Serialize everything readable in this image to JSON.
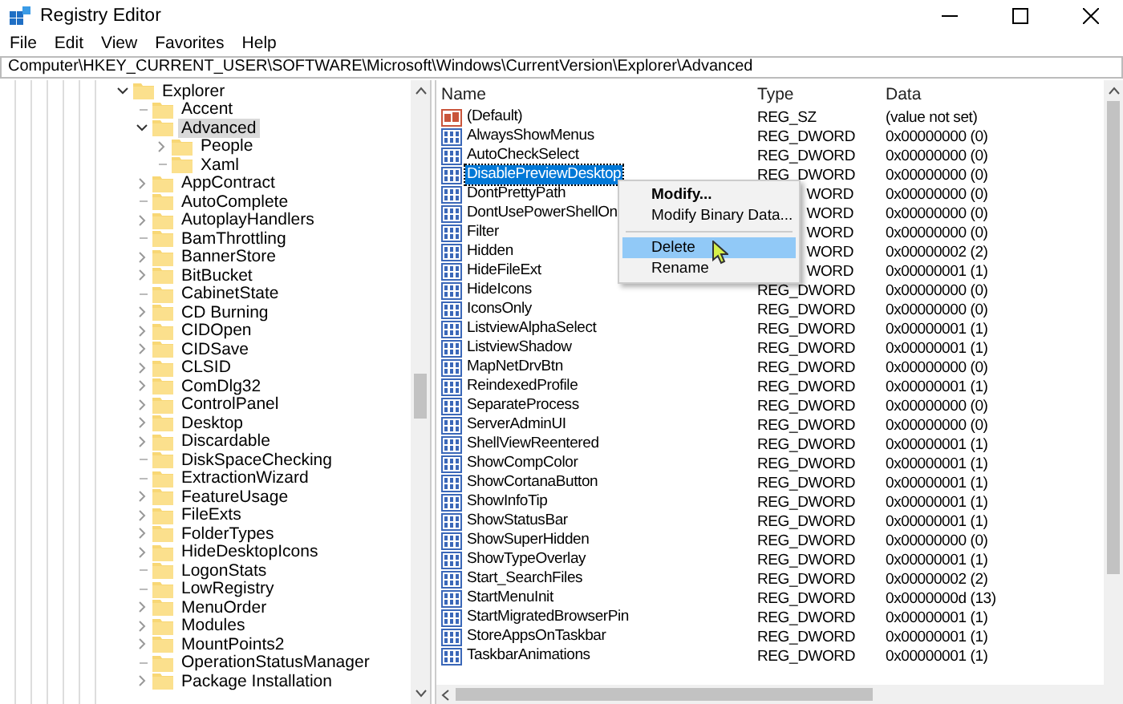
{
  "window": {
    "title": "Registry Editor"
  },
  "menu": [
    "File",
    "Edit",
    "View",
    "Favorites",
    "Help"
  ],
  "address": "Computer\\HKEY_CURRENT_USER\\SOFTWARE\\Microsoft\\Windows\\CurrentVersion\\Explorer\\Advanced",
  "tree": [
    {
      "label": "Explorer",
      "kind": "branch",
      "expanded": true,
      "selected": false,
      "children": [
        {
          "label": "Accent",
          "kind": "leaf",
          "expanded": false,
          "selected": false
        },
        {
          "label": "Advanced",
          "kind": "branch",
          "expanded": true,
          "selected": true,
          "children": [
            {
              "label": "People",
              "kind": "branch",
              "expanded": false,
              "selected": false
            },
            {
              "label": "Xaml",
              "kind": "leaf",
              "expanded": false,
              "selected": false
            }
          ]
        },
        {
          "label": "AppContract",
          "kind": "branch",
          "expanded": false,
          "selected": false
        },
        {
          "label": "AutoComplete",
          "kind": "leaf",
          "expanded": false,
          "selected": false
        },
        {
          "label": "AutoplayHandlers",
          "kind": "branch",
          "expanded": false,
          "selected": false
        },
        {
          "label": "BamThrottling",
          "kind": "leaf",
          "expanded": false,
          "selected": false
        },
        {
          "label": "BannerStore",
          "kind": "branch",
          "expanded": false,
          "selected": false
        },
        {
          "label": "BitBucket",
          "kind": "branch",
          "expanded": false,
          "selected": false
        },
        {
          "label": "CabinetState",
          "kind": "leaf",
          "expanded": false,
          "selected": false
        },
        {
          "label": "CD Burning",
          "kind": "branch",
          "expanded": false,
          "selected": false
        },
        {
          "label": "CIDOpen",
          "kind": "branch",
          "expanded": false,
          "selected": false
        },
        {
          "label": "CIDSave",
          "kind": "branch",
          "expanded": false,
          "selected": false
        },
        {
          "label": "CLSID",
          "kind": "branch",
          "expanded": false,
          "selected": false
        },
        {
          "label": "ComDlg32",
          "kind": "branch",
          "expanded": false,
          "selected": false
        },
        {
          "label": "ControlPanel",
          "kind": "branch",
          "expanded": false,
          "selected": false
        },
        {
          "label": "Desktop",
          "kind": "branch",
          "expanded": false,
          "selected": false
        },
        {
          "label": "Discardable",
          "kind": "branch",
          "expanded": false,
          "selected": false
        },
        {
          "label": "DiskSpaceChecking",
          "kind": "leaf",
          "expanded": false,
          "selected": false
        },
        {
          "label": "ExtractionWizard",
          "kind": "leaf",
          "expanded": false,
          "selected": false
        },
        {
          "label": "FeatureUsage",
          "kind": "branch",
          "expanded": false,
          "selected": false
        },
        {
          "label": "FileExts",
          "kind": "branch",
          "expanded": false,
          "selected": false
        },
        {
          "label": "FolderTypes",
          "kind": "branch",
          "expanded": false,
          "selected": false
        },
        {
          "label": "HideDesktopIcons",
          "kind": "branch",
          "expanded": false,
          "selected": false
        },
        {
          "label": "LogonStats",
          "kind": "leaf",
          "expanded": false,
          "selected": false
        },
        {
          "label": "LowRegistry",
          "kind": "leaf",
          "expanded": false,
          "selected": false
        },
        {
          "label": "MenuOrder",
          "kind": "branch",
          "expanded": false,
          "selected": false
        },
        {
          "label": "Modules",
          "kind": "branch",
          "expanded": false,
          "selected": false
        },
        {
          "label": "MountPoints2",
          "kind": "branch",
          "expanded": false,
          "selected": false
        },
        {
          "label": "OperationStatusManager",
          "kind": "leaf",
          "expanded": false,
          "selected": false
        },
        {
          "label": "Package Installation",
          "kind": "branch",
          "expanded": false,
          "selected": false
        }
      ]
    }
  ],
  "columns": [
    "Name",
    "Type",
    "Data"
  ],
  "values": [
    {
      "name": "(Default)",
      "kind": "string",
      "type": "REG_SZ",
      "data": "(value not set)",
      "selected": false
    },
    {
      "name": "AlwaysShowMenus",
      "kind": "dword",
      "type": "REG_DWORD",
      "data": "0x00000000 (0)",
      "selected": false
    },
    {
      "name": "AutoCheckSelect",
      "kind": "dword",
      "type": "REG_DWORD",
      "data": "0x00000000 (0)",
      "selected": false
    },
    {
      "name": "DisablePreviewDesktop",
      "kind": "dword",
      "type": "REG_DWORD",
      "data": "0x00000000 (0)",
      "selected": true
    },
    {
      "name": "DontPrettyPath",
      "kind": "dword",
      "type": "WORD",
      "data": "0x00000000 (0)",
      "selected": false
    },
    {
      "name": "DontUsePowerShellOn",
      "kind": "dword",
      "type": "WORD",
      "data": "0x00000000 (0)",
      "selected": false
    },
    {
      "name": "Filter",
      "kind": "dword",
      "type": "WORD",
      "data": "0x00000000 (0)",
      "selected": false
    },
    {
      "name": "Hidden",
      "kind": "dword",
      "type": "WORD",
      "data": "0x00000002 (2)",
      "selected": false
    },
    {
      "name": "HideFileExt",
      "kind": "dword",
      "type": "WORD",
      "data": "0x00000001 (1)",
      "selected": false
    },
    {
      "name": "HideIcons",
      "kind": "dword",
      "type": "REG_DWORD",
      "data": "0x00000000 (0)",
      "selected": false
    },
    {
      "name": "IconsOnly",
      "kind": "dword",
      "type": "REG_DWORD",
      "data": "0x00000000 (0)",
      "selected": false
    },
    {
      "name": "ListviewAlphaSelect",
      "kind": "dword",
      "type": "REG_DWORD",
      "data": "0x00000001 (1)",
      "selected": false
    },
    {
      "name": "ListviewShadow",
      "kind": "dword",
      "type": "REG_DWORD",
      "data": "0x00000001 (1)",
      "selected": false
    },
    {
      "name": "MapNetDrvBtn",
      "kind": "dword",
      "type": "REG_DWORD",
      "data": "0x00000000 (0)",
      "selected": false
    },
    {
      "name": "ReindexedProfile",
      "kind": "dword",
      "type": "REG_DWORD",
      "data": "0x00000001 (1)",
      "selected": false
    },
    {
      "name": "SeparateProcess",
      "kind": "dword",
      "type": "REG_DWORD",
      "data": "0x00000000 (0)",
      "selected": false
    },
    {
      "name": "ServerAdminUI",
      "kind": "dword",
      "type": "REG_DWORD",
      "data": "0x00000000 (0)",
      "selected": false
    },
    {
      "name": "ShellViewReentered",
      "kind": "dword",
      "type": "REG_DWORD",
      "data": "0x00000001 (1)",
      "selected": false
    },
    {
      "name": "ShowCompColor",
      "kind": "dword",
      "type": "REG_DWORD",
      "data": "0x00000001 (1)",
      "selected": false
    },
    {
      "name": "ShowCortanaButton",
      "kind": "dword",
      "type": "REG_DWORD",
      "data": "0x00000001 (1)",
      "selected": false
    },
    {
      "name": "ShowInfoTip",
      "kind": "dword",
      "type": "REG_DWORD",
      "data": "0x00000001 (1)",
      "selected": false
    },
    {
      "name": "ShowStatusBar",
      "kind": "dword",
      "type": "REG_DWORD",
      "data": "0x00000001 (1)",
      "selected": false
    },
    {
      "name": "ShowSuperHidden",
      "kind": "dword",
      "type": "REG_DWORD",
      "data": "0x00000000 (0)",
      "selected": false
    },
    {
      "name": "ShowTypeOverlay",
      "kind": "dword",
      "type": "REG_DWORD",
      "data": "0x00000001 (1)",
      "selected": false
    },
    {
      "name": "Start_SearchFiles",
      "kind": "dword",
      "type": "REG_DWORD",
      "data": "0x00000002 (2)",
      "selected": false
    },
    {
      "name": "StartMenuInit",
      "kind": "dword",
      "type": "REG_DWORD",
      "data": "0x0000000d (13)",
      "selected": false
    },
    {
      "name": "StartMigratedBrowserPin",
      "kind": "dword",
      "type": "REG_DWORD",
      "data": "0x00000001 (1)",
      "selected": false
    },
    {
      "name": "StoreAppsOnTaskbar",
      "kind": "dword",
      "type": "REG_DWORD",
      "data": "0x00000001 (1)",
      "selected": false
    },
    {
      "name": "TaskbarAnimations",
      "kind": "dword",
      "type": "REG_DWORD",
      "data": "0x00000001 (1)",
      "selected": false
    }
  ],
  "context_menu": [
    {
      "kind": "item",
      "label": "Modify...",
      "default": true,
      "selected": false
    },
    {
      "kind": "item",
      "label": "Modify Binary Data...",
      "default": false,
      "selected": false
    },
    {
      "kind": "separator"
    },
    {
      "kind": "item",
      "label": "Delete",
      "default": false,
      "selected": true
    },
    {
      "kind": "item",
      "label": "Rename",
      "default": false,
      "selected": false
    }
  ]
}
